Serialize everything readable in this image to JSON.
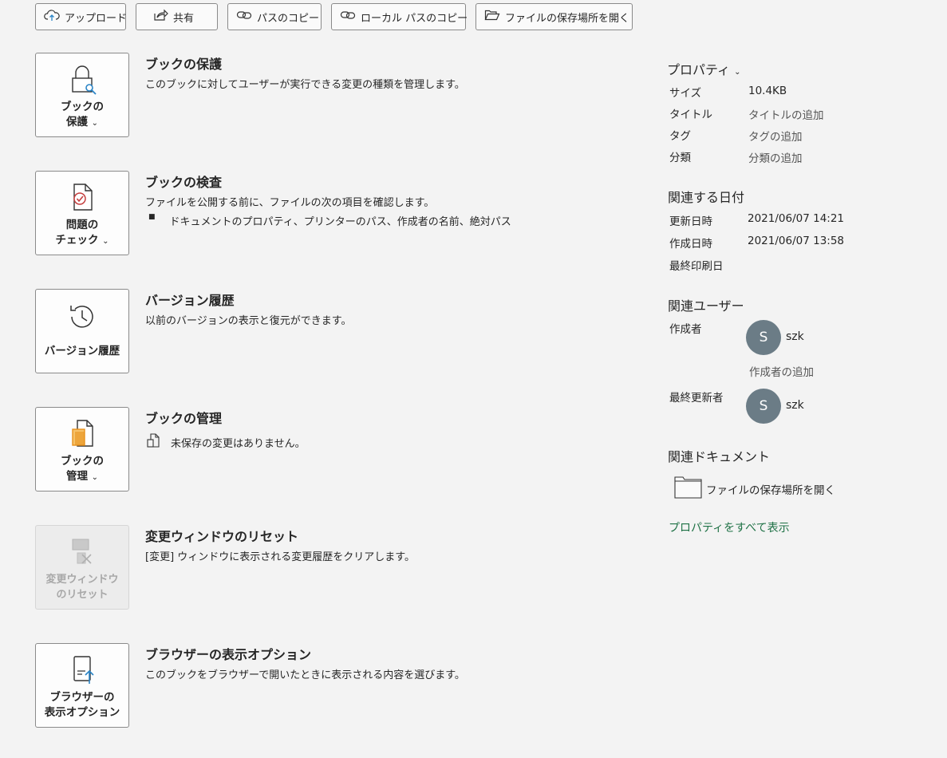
{
  "toolbar": {
    "upload": "アップロード",
    "share": "共有",
    "copy_path": "パスのコピー",
    "copy_local_path": "ローカル パスのコピー",
    "open_location": "ファイルの保存場所を開く"
  },
  "sections": {
    "protect": {
      "tile_label": "ブックの\n保護",
      "title": "ブックの保護",
      "desc": "このブックに対してユーザーが実行できる変更の種類を管理します。"
    },
    "inspect": {
      "tile_label": "問題の\nチェック",
      "title": "ブックの検査",
      "desc": "ファイルを公開する前に、ファイルの次の項目を確認します。",
      "bullet": "ドキュメントのプロパティ、プリンターのパス、作成者の名前、絶対パス"
    },
    "version": {
      "tile_label": "バージョン履歴",
      "title": "バージョン履歴",
      "desc": "以前のバージョンの表示と復元ができます。"
    },
    "manage": {
      "tile_label": "ブックの\n管理",
      "title": "ブックの管理",
      "status": "未保存の変更はありません。"
    },
    "reset_changes": {
      "tile_label": "変更ウィンドウ\nのリセット",
      "title": "変更ウィンドウのリセット",
      "desc": "[変更] ウィンドウに表示される変更履歴をクリアします。"
    },
    "browser_view": {
      "tile_label": "ブラウザーの\n表示オプション",
      "title": "ブラウザーの表示オプション",
      "desc": "このブックをブラウザーで開いたときに表示される内容を選びます。"
    }
  },
  "properties": {
    "header": "プロパティ",
    "size_key": "サイズ",
    "size_val": "10.4KB",
    "title_key": "タイトル",
    "title_val": "タイトルの追加",
    "tag_key": "タグ",
    "tag_val": "タグの追加",
    "category_key": "分類",
    "category_val": "分類の追加"
  },
  "dates": {
    "header": "関連する日付",
    "modified_key": "更新日時",
    "modified_val": "2021/06/07 14:21",
    "created_key": "作成日時",
    "created_val": "2021/06/07 13:58",
    "printed_key": "最終印刷日"
  },
  "people": {
    "header": "関連ユーザー",
    "author_key": "作成者",
    "author_initial": "S",
    "author_name": "szk",
    "add_author": "作成者の追加",
    "last_modified_key": "最終更新者",
    "modifier_initial": "S",
    "modifier_name": "szk"
  },
  "documents": {
    "header": "関連ドキュメント",
    "open_location": "ファイルの保存場所を開く"
  },
  "show_all_properties": "プロパティをすべて表示",
  "colors": {
    "background": "#f3f3f3",
    "link": "#1e7145",
    "avatar": "#6b7c86",
    "accent_orange": "#e8911c",
    "accent_blue": "#2a84c6",
    "check_red": "#c43e3e"
  }
}
